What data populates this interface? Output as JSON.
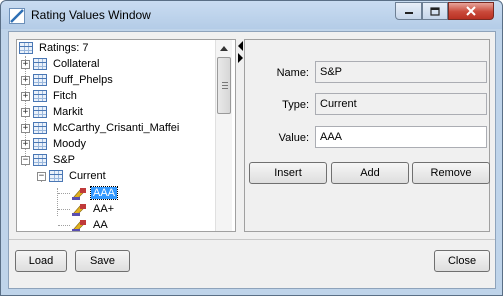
{
  "window": {
    "title": "Rating Values Window",
    "buttons": {
      "minimize": "minimize",
      "maximize": "maximize",
      "close": "close"
    }
  },
  "tree": {
    "root": "Ratings: 7",
    "agencies": [
      "Collateral",
      "Duff_Phelps",
      "Fitch",
      "Markit",
      "McCarthy_Crisanti_Maffei",
      "Moody",
      "S&P"
    ],
    "expanded_agency": "S&P",
    "child_group": "Current",
    "values": [
      "AAA",
      "AA+",
      "AA"
    ],
    "selected_value": "AAA"
  },
  "detail": {
    "name_label": "Name:",
    "name_value": "S&P",
    "type_label": "Type:",
    "type_value": "Current",
    "value_label": "Value:",
    "value_value": "AAA"
  },
  "actions": {
    "insert": "Insert",
    "add": "Add",
    "remove": "Remove"
  },
  "footer": {
    "load": "Load",
    "save": "Save",
    "close": "Close"
  },
  "colors": {
    "selection": "#3399ff",
    "titlebar": "#c9dcf1",
    "close_button": "#c9493a"
  }
}
